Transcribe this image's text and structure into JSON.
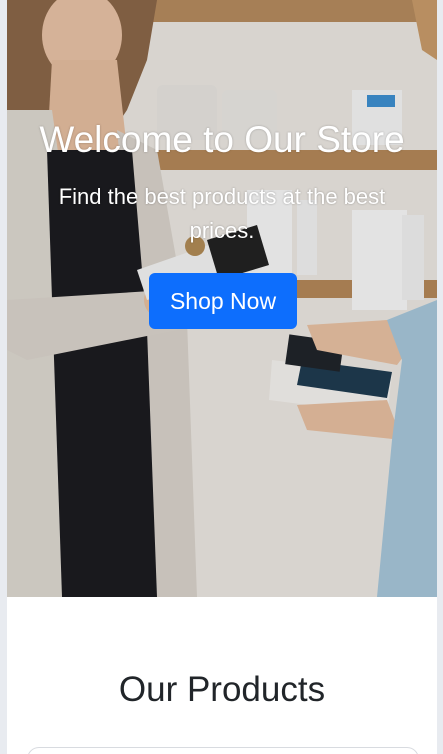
{
  "hero": {
    "title": "Welcome to Our Store",
    "subtitle": "Find the best products at the best prices.",
    "button_label": "Shop Now",
    "image_description_icon": "store-photo"
  },
  "products": {
    "title": "Our Products"
  },
  "colors": {
    "primary_button": "#0d6efd",
    "hero_text": "#ffffff",
    "heading_text": "#212529"
  }
}
